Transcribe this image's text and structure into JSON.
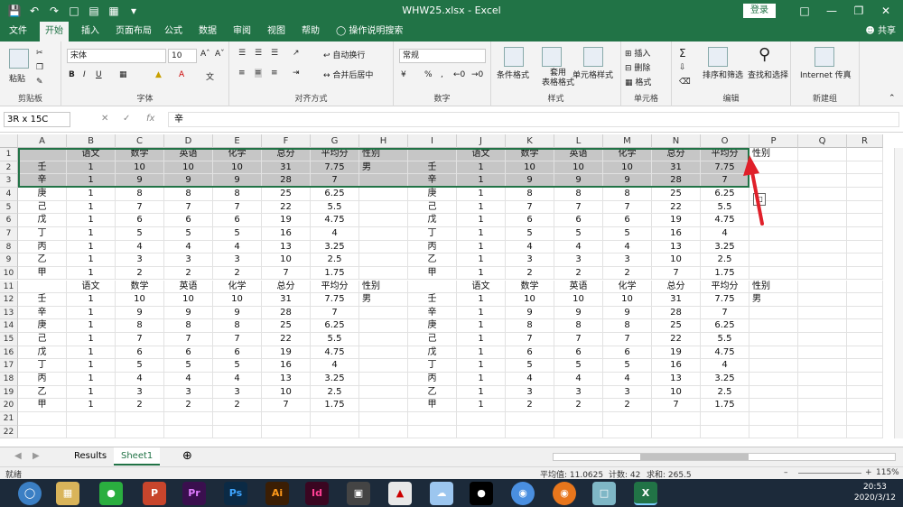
{
  "window": {
    "title": "WHW25.xlsx  -  Excel",
    "login": "登录"
  },
  "tabs": [
    "文件",
    "开始",
    "插入",
    "页面布局",
    "公式",
    "数据",
    "审阅",
    "视图",
    "帮助"
  ],
  "tell_me": "操作说明搜索",
  "share": "共享",
  "ribbon": {
    "paste": "粘贴",
    "clipboard": "剪贴板",
    "font_name": "宋体",
    "font_size": "10",
    "font": "字体",
    "wrap": "自动换行",
    "merge": "合并后居中",
    "alignment": "对齐方式",
    "number_format": "常规",
    "number": "数字",
    "conditional": "条件格式",
    "table_format": "套用\n表格格式",
    "cell_style": "单元格样式",
    "styles": "样式",
    "insert": "插入",
    "delete": "删除",
    "format": "格式",
    "cells": "单元格",
    "sort": "排序和筛选",
    "find": "查找和选择",
    "editing": "编辑",
    "internet": "Internet 传真",
    "new_group": "新建组"
  },
  "formula_bar": {
    "namebox": "3R x 15C",
    "formula": "辛"
  },
  "columns": [
    "A",
    "B",
    "C",
    "D",
    "E",
    "F",
    "G",
    "H",
    "I",
    "J",
    "K",
    "L",
    "M",
    "N",
    "O",
    "P",
    "Q",
    "R"
  ],
  "headers": [
    "语文",
    "数学",
    "英语",
    "化学",
    "总分",
    "平均分",
    "性别"
  ],
  "names": [
    "壬",
    "辛",
    "庚",
    "己",
    "戊",
    "丁",
    "丙",
    "乙",
    "甲"
  ],
  "rows": [
    [
      "壬",
      "1",
      "10",
      "10",
      "10",
      "31",
      "7.75",
      "男"
    ],
    [
      "辛",
      "1",
      "9",
      "9",
      "9",
      "28",
      "7",
      ""
    ],
    [
      "庚",
      "1",
      "8",
      "8",
      "8",
      "25",
      "6.25",
      ""
    ],
    [
      "己",
      "1",
      "7",
      "7",
      "7",
      "22",
      "5.5",
      ""
    ],
    [
      "戊",
      "1",
      "6",
      "6",
      "6",
      "19",
      "4.75",
      ""
    ],
    [
      "丁",
      "1",
      "5",
      "5",
      "5",
      "16",
      "4",
      ""
    ],
    [
      "丙",
      "1",
      "4",
      "4",
      "4",
      "13",
      "3.25",
      ""
    ],
    [
      "乙",
      "1",
      "3",
      "3",
      "3",
      "10",
      "2.5",
      ""
    ],
    [
      "甲",
      "1",
      "2",
      "2",
      "2",
      "7",
      "1.75",
      ""
    ]
  ],
  "sheets": [
    "Results",
    "Sheet1"
  ],
  "status": {
    "ready": "就绪",
    "average": "平均值: 11.0625",
    "count": "计数: 42",
    "sum": "求和: 265.5",
    "zoom": "115%"
  },
  "clock": {
    "time": "20:53",
    "date": "2020/3/12"
  },
  "colors": {
    "excel_green": "#217346",
    "arrow_red": "#e0202a"
  }
}
